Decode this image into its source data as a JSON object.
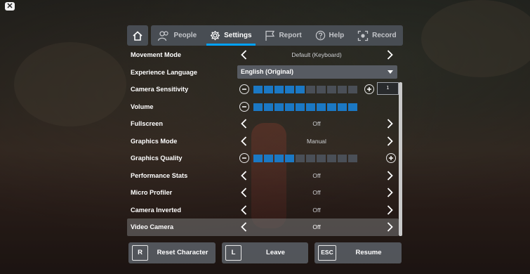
{
  "tabs": {
    "home_icon": "home-icon",
    "items": [
      {
        "label": "People",
        "icon": "people-icon"
      },
      {
        "label": "Settings",
        "icon": "gear-icon"
      },
      {
        "label": "Report",
        "icon": "flag-icon"
      },
      {
        "label": "Help",
        "icon": "question-icon"
      },
      {
        "label": "Record",
        "icon": "record-icon"
      }
    ],
    "active": "Settings"
  },
  "settings": {
    "movement_mode": {
      "label": "Movement Mode",
      "value": "Default (Keyboard)"
    },
    "experience_language": {
      "label": "Experience Language",
      "value": "English (Original)"
    },
    "camera_sensitivity": {
      "label": "Camera Sensitivity",
      "level": 5,
      "max": 10,
      "input_value": "1"
    },
    "volume": {
      "label": "Volume",
      "level": 10,
      "max": 10
    },
    "fullscreen": {
      "label": "Fullscreen",
      "value": "Off"
    },
    "graphics_mode": {
      "label": "Graphics Mode",
      "value": "Manual"
    },
    "graphics_quality": {
      "label": "Graphics Quality",
      "level": 4,
      "max": 10
    },
    "performance_stats": {
      "label": "Performance Stats",
      "value": "Off"
    },
    "micro_profiler": {
      "label": "Micro Profiler",
      "value": "Off"
    },
    "camera_inverted": {
      "label": "Camera Inverted",
      "value": "Off"
    },
    "video_camera": {
      "label": "Video Camera",
      "value": "Off"
    }
  },
  "actions": {
    "reset": {
      "key": "R",
      "label": "Reset Character"
    },
    "leave": {
      "key": "L",
      "label": "Leave"
    },
    "resume": {
      "key": "ESC",
      "label": "Resume"
    }
  },
  "colors": {
    "accent": "#00a2ff",
    "slider_on": "#1b78c4",
    "slider_off": "#4a4f57"
  }
}
